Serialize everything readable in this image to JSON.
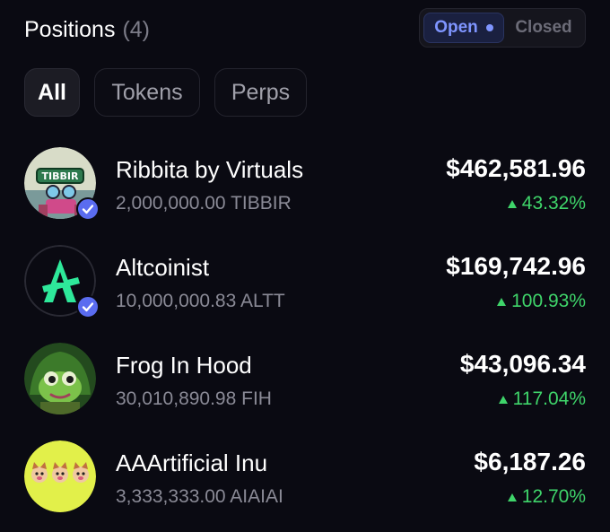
{
  "header": {
    "title": "Positions",
    "count": "(4)"
  },
  "toggle": {
    "open_label": "Open",
    "closed_label": "Closed",
    "selected": "Open",
    "accent": "#7f95ff"
  },
  "filters": [
    {
      "label": "All",
      "active": true
    },
    {
      "label": "Tokens",
      "active": false
    },
    {
      "label": "Perps",
      "active": false
    }
  ],
  "positions": [
    {
      "name": "Ribbita by Virtuals",
      "amount": "2,000,000.00 TIBBIR",
      "value": "$462,581.96",
      "change": "43.32%",
      "verified": true,
      "avatar_text": "TIBBIR",
      "avatar_icon": "frog-robot-icon"
    },
    {
      "name": "Altcoinist",
      "amount": "10,000,000.83 ALTT",
      "value": "$169,742.96",
      "change": "100.93%",
      "verified": true,
      "avatar_icon": "altcoinist-logo-icon"
    },
    {
      "name": "Frog In Hood",
      "amount": "30,010,890.98 FIH",
      "value": "$43,096.34",
      "change": "117.04%",
      "verified": false,
      "avatar_icon": "hooded-frog-icon"
    },
    {
      "name": "AAArtificial Inu",
      "amount": "3,333,333.00 AIAIAI",
      "value": "$6,187.26",
      "change": "12.70%",
      "verified": false,
      "avatar_icon": "three-dogs-icon"
    }
  ],
  "colors": {
    "positive": "#3fd46a",
    "verified_badge": "#5a6cf0",
    "background": "#0a0a12"
  }
}
